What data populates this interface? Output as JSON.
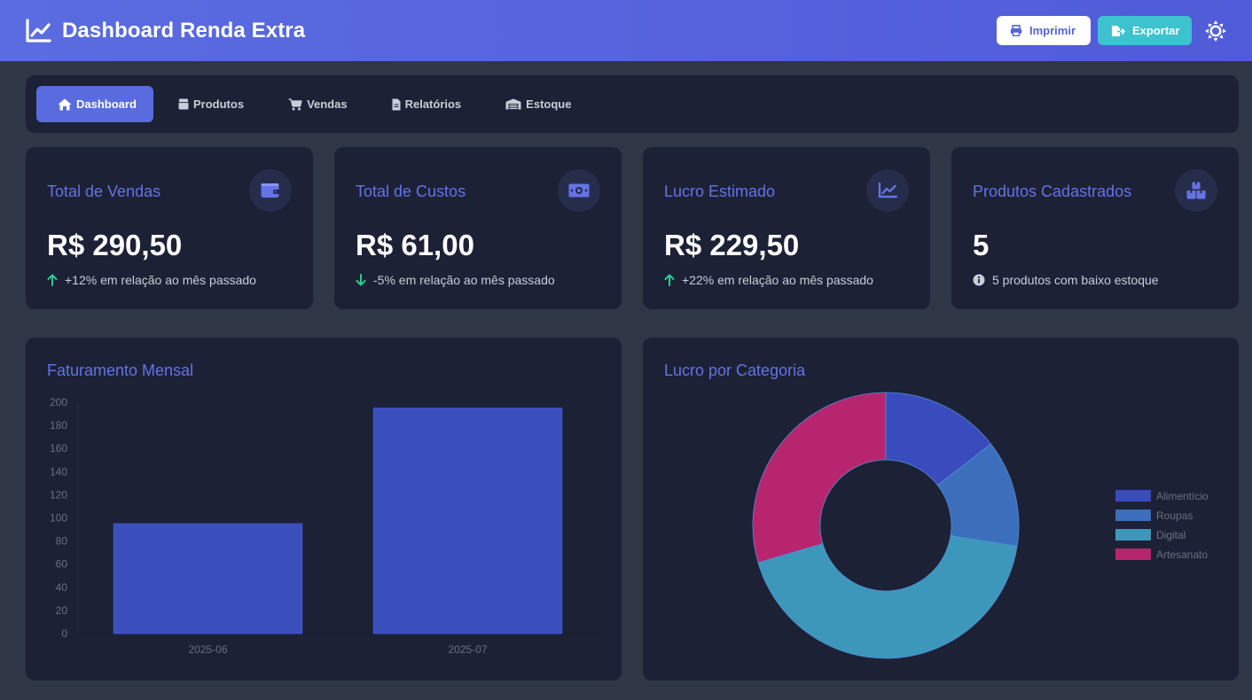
{
  "header": {
    "title": "Dashboard Renda Extra",
    "print_label": "Imprimir",
    "export_label": "Exportar"
  },
  "nav": {
    "items": [
      {
        "label": "Dashboard",
        "icon": "home-icon",
        "active": true
      },
      {
        "label": "Produtos",
        "icon": "box-icon",
        "active": false
      },
      {
        "label": "Vendas",
        "icon": "cart-icon",
        "active": false
      },
      {
        "label": "Relatórios",
        "icon": "file-icon",
        "active": false
      },
      {
        "label": "Estoque",
        "icon": "warehouse-icon",
        "active": false
      }
    ]
  },
  "stats": [
    {
      "title": "Total de Vendas",
      "value": "R$ 290,50",
      "note": "+12% em relação ao mês passado",
      "icon": "wallet-icon",
      "trend": "up"
    },
    {
      "title": "Total de Custos",
      "value": "R$ 61,00",
      "note": "-5% em relação ao mês passado",
      "icon": "money-bill-icon",
      "trend": "down"
    },
    {
      "title": "Lucro Estimado",
      "value": "R$ 229,50",
      "note": "+22% em relação ao mês passado",
      "icon": "chart-line-icon",
      "trend": "up"
    },
    {
      "title": "Produtos Cadastrados",
      "value": "5",
      "note": "5 produtos com baixo estoque",
      "icon": "boxes-icon",
      "trend": "info"
    }
  ],
  "colors": {
    "accent": "#5a6be0",
    "up": "#2ecc8f",
    "down": "#2ecc8f",
    "bar": "#3a4fbc"
  },
  "charts": {
    "revenue_title": "Faturamento Mensal",
    "category_title": "Lucro por Categoria"
  },
  "chart_data": [
    {
      "type": "bar",
      "title": "Faturamento Mensal",
      "categories": [
        "2025-06",
        "2025-07"
      ],
      "values": [
        95,
        195
      ],
      "ylim": [
        0,
        200
      ],
      "yticks": [
        0,
        20,
        40,
        60,
        80,
        100,
        120,
        140,
        160,
        180,
        200
      ],
      "grid": false
    },
    {
      "type": "pie",
      "title": "Lucro por Categoria",
      "labels": [
        "Alimentício",
        "Roupas",
        "Digital",
        "Artesanato"
      ],
      "values": [
        14.5,
        13,
        43,
        29.5
      ],
      "colors": [
        "#3a4bbd",
        "#3b6ebb",
        "#3d97bb",
        "#b8256f"
      ],
      "legend_position": "right"
    }
  ]
}
